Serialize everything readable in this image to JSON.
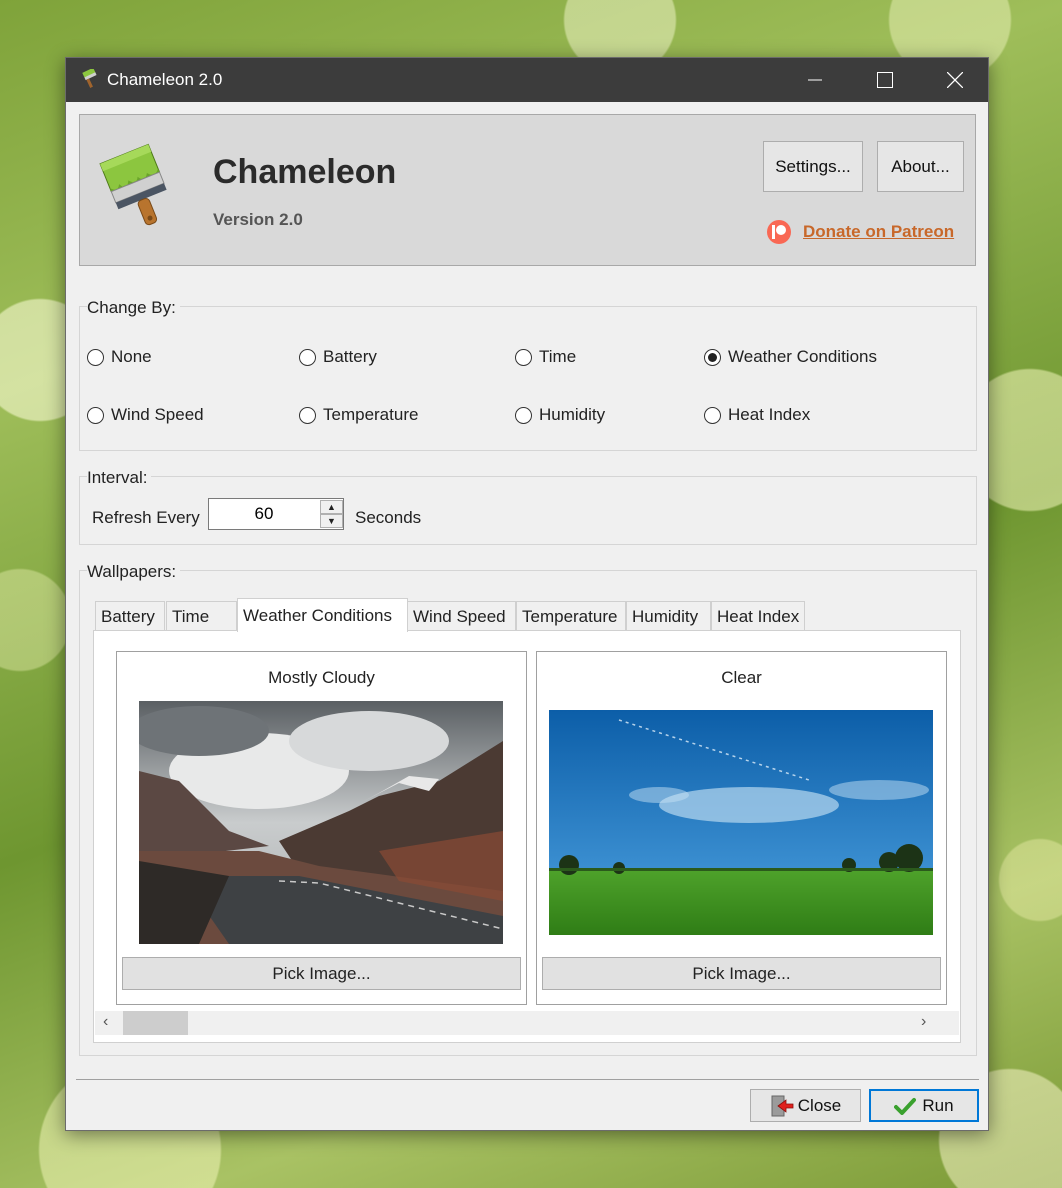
{
  "window": {
    "title": "Chameleon 2.0",
    "controls": {
      "minimize": "—",
      "maximize": "☐",
      "close": "✕"
    }
  },
  "header": {
    "app_name": "Chameleon",
    "version": "Version 2.0",
    "settings_label": "Settings...",
    "about_label": "About...",
    "donate_label": "Donate on Patreon",
    "donate_color": "#c8682a"
  },
  "change_by": {
    "label": "Change By:",
    "options": [
      {
        "label": "None",
        "checked": false
      },
      {
        "label": "Battery",
        "checked": false
      },
      {
        "label": "Time",
        "checked": false
      },
      {
        "label": "Weather Conditions",
        "checked": true
      },
      {
        "label": "Wind Speed",
        "checked": false
      },
      {
        "label": "Temperature",
        "checked": false
      },
      {
        "label": "Humidity",
        "checked": false
      },
      {
        "label": "Heat Index",
        "checked": false
      }
    ]
  },
  "interval": {
    "label": "Interval:",
    "refresh_label": "Refresh Every",
    "value": "60",
    "unit": "Seconds"
  },
  "wallpapers": {
    "label": "Wallpapers:",
    "tabs": [
      "Battery",
      "Time",
      "Weather Conditions",
      "Wind Speed",
      "Temperature",
      "Humidity",
      "Heat Index"
    ],
    "active_tab": "Weather Conditions",
    "cards": [
      {
        "title": "Mostly Cloudy",
        "button": "Pick Image..."
      },
      {
        "title": "Clear",
        "button": "Pick Image..."
      }
    ]
  },
  "footer": {
    "close_label": "Close",
    "run_label": "Run",
    "accent": "#0078d7"
  }
}
